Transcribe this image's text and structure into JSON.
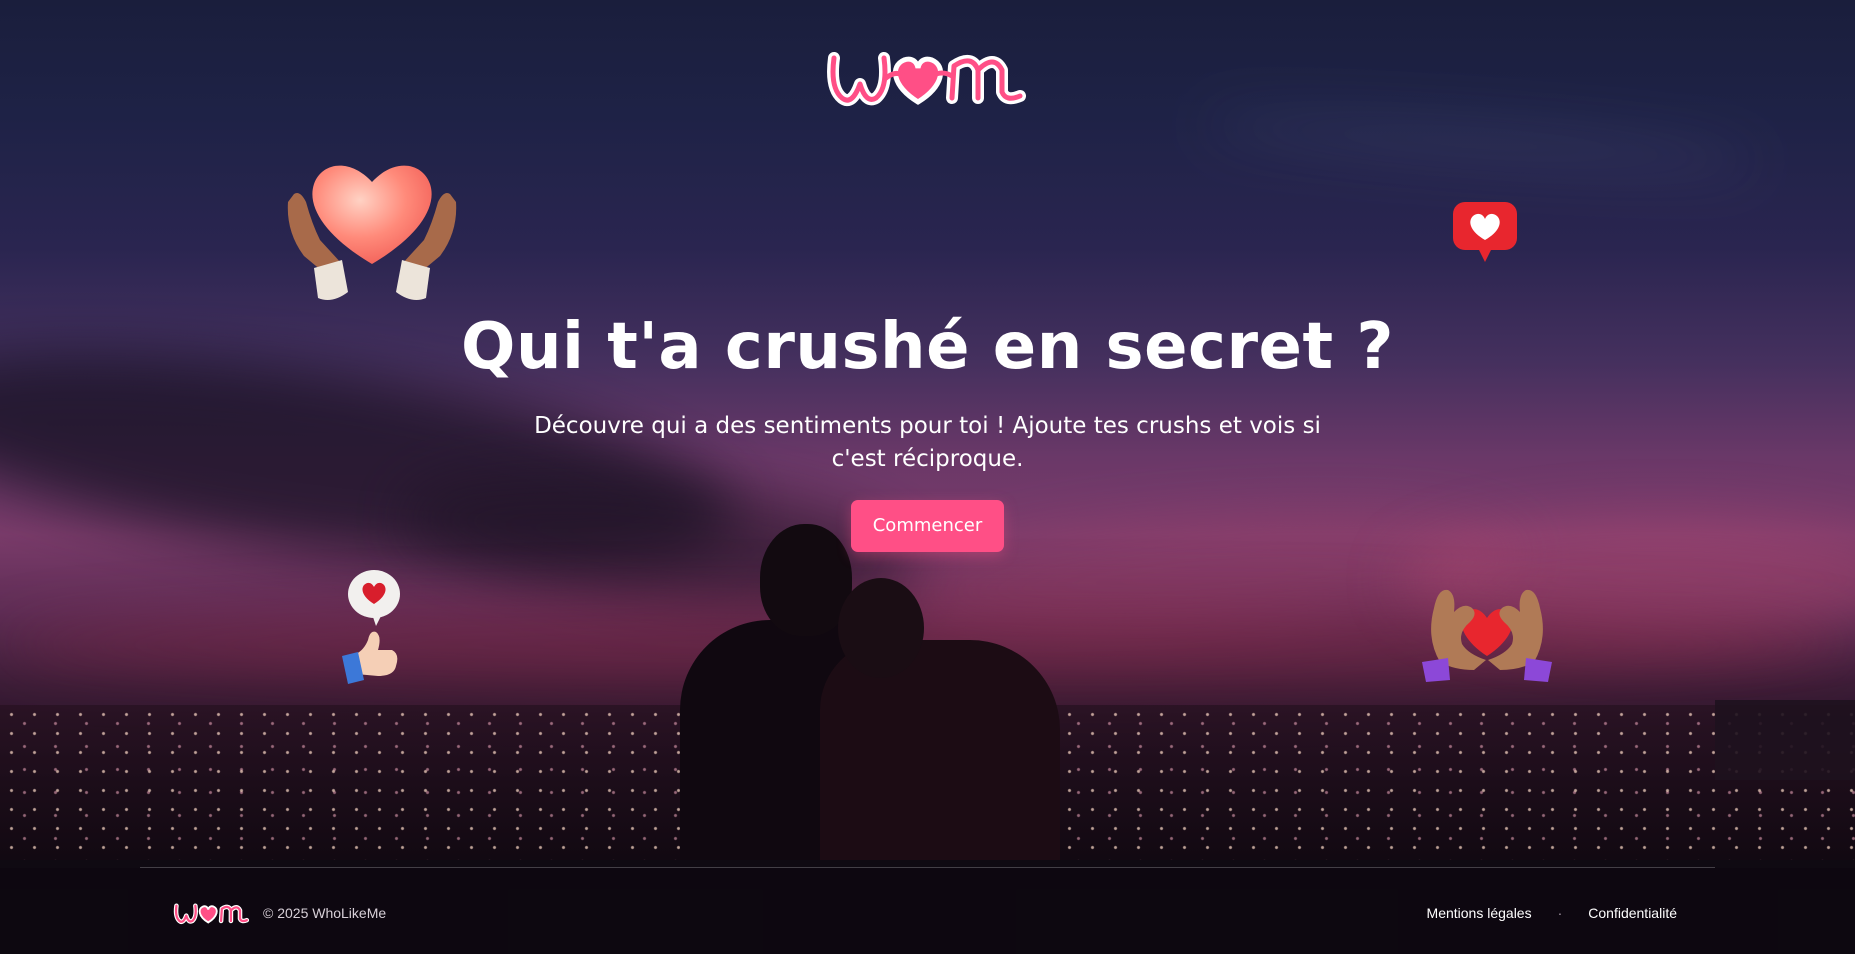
{
  "header": {
    "logo_text": "wlm"
  },
  "hero": {
    "title": "Qui t'a crushé en secret ?",
    "subtitle": "Découvre qui a des sentiments pour toi ! Ajoute tes crushs et vois si c'est réciproque.",
    "cta_label": "Commencer"
  },
  "decorations": [
    {
      "icon": "heart-hands-icon"
    },
    {
      "icon": "heart-notification-icon"
    },
    {
      "icon": "thumbs-up-heart-icon"
    },
    {
      "icon": "hands-heart-gesture-icon"
    }
  ],
  "footer": {
    "logo_text": "wlm",
    "copyright": "© 2025 WhoLikeMe",
    "links": [
      "Mentions légales",
      "Confidentialité"
    ],
    "separator": "·"
  },
  "colors": {
    "accent": "#ff4f86",
    "text": "#ffffff"
  }
}
